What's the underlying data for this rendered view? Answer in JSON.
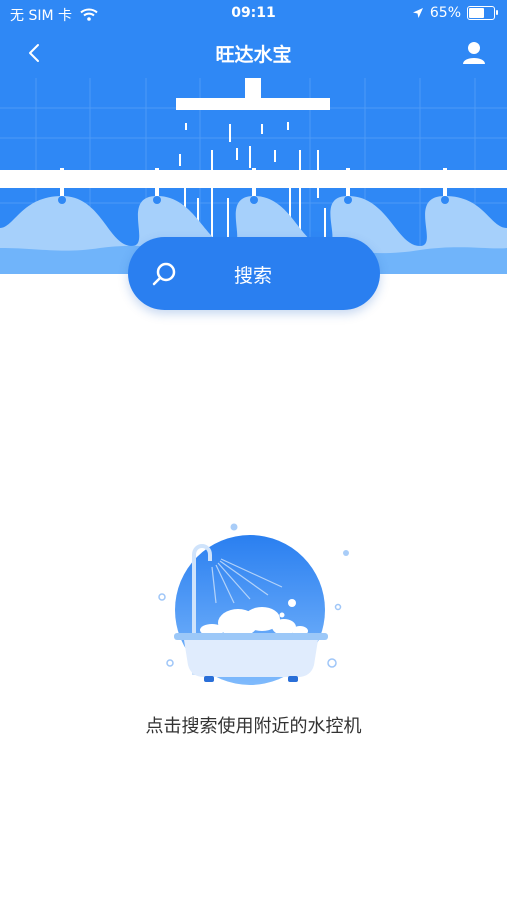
{
  "status_bar": {
    "carrier": "无 SIM 卡",
    "time": "09:11",
    "battery": "65%",
    "battery_level": 0.65
  },
  "nav": {
    "title": "旺达水宝"
  },
  "search": {
    "label": "搜索"
  },
  "empty_state": {
    "hint": "点击搜索使用附近的水控机"
  },
  "colors": {
    "primary": "#2f88f5",
    "button": "#2a7ff0",
    "light": "#6ab0fa"
  },
  "icons": [
    "wifi-icon",
    "location-icon",
    "battery-icon",
    "back-icon",
    "user-icon",
    "search-icon",
    "bathtub-illustration"
  ]
}
